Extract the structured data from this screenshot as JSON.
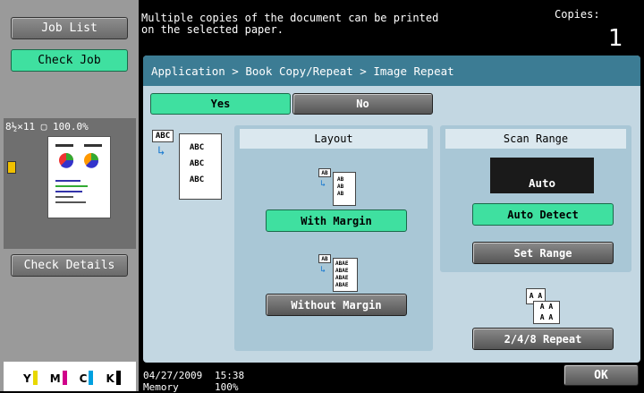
{
  "left_panel": {
    "job_list": "Job List",
    "check_job": "Check Job",
    "preview_status": "8½×11  ▢  100.0%",
    "check_details": "Check Details",
    "toner": [
      {
        "label": "Y",
        "color": "#e8d800"
      },
      {
        "label": "M",
        "color": "#d0008a"
      },
      {
        "label": "C",
        "color": "#00a0e0"
      },
      {
        "label": "K",
        "color": "#000000"
      }
    ]
  },
  "header": {
    "message": "Multiple copies of the document can be printed\non the selected paper.",
    "copies_label": "Copies:",
    "copies_value": "1"
  },
  "breadcrumb": "Application > Book Copy/Repeat > Image Repeat",
  "toggle": {
    "yes": "Yes",
    "no": "No"
  },
  "icon_text": {
    "abc": "ABC",
    "ab": "AB",
    "abae": "AB AE",
    "aa": "A A"
  },
  "layout": {
    "title": "Layout",
    "with_margin": "With Margin",
    "without_margin": "Without Margin"
  },
  "scan_range": {
    "title": "Scan Range",
    "display": "Auto",
    "auto_detect": "Auto Detect",
    "set_range": "Set Range",
    "repeat": "2/4/8 Repeat"
  },
  "status_bar": {
    "date": "04/27/2009",
    "time": "15:38",
    "memory_label": "Memory",
    "memory_value": "100%",
    "ok": "OK"
  },
  "colors": {
    "accent_green": "#3fe0a0",
    "breadcrumb_bg": "#3c7c94",
    "panel_bg": "#c3d7e2"
  }
}
